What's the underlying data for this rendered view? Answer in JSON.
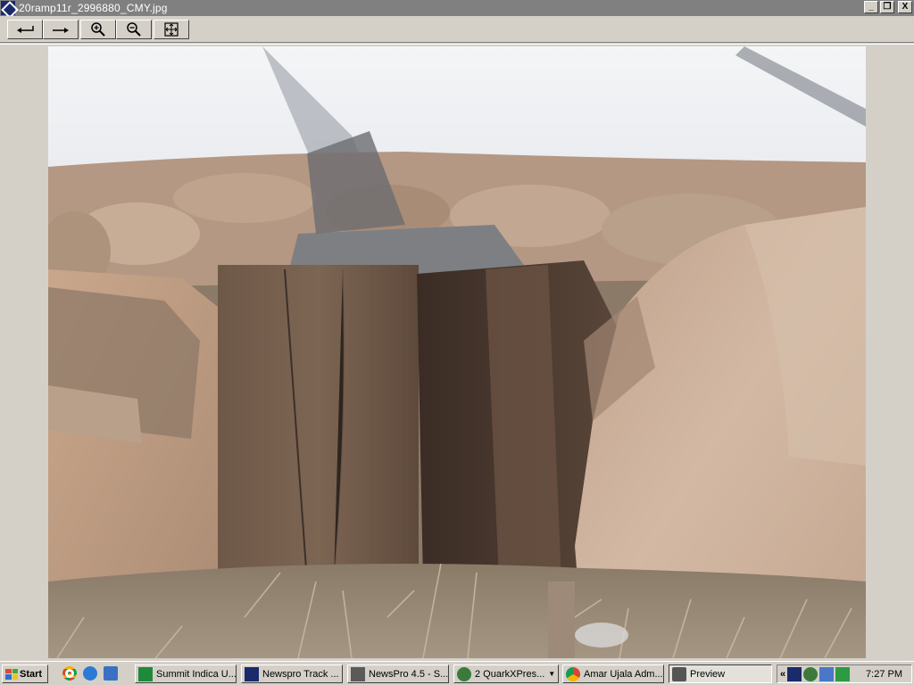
{
  "window": {
    "title": "20ramp11r_2996880_CMY.jpg",
    "minimize_label": "_",
    "restore_label": "❐",
    "close_label": "X"
  },
  "toolbar": {
    "buttons": [
      {
        "name": "previous-button",
        "icon": "arrow-left-icon"
      },
      {
        "name": "next-button",
        "icon": "arrow-right-icon"
      },
      {
        "name": "zoom-in-button",
        "icon": "zoom-in-icon"
      },
      {
        "name": "zoom-out-button",
        "icon": "zoom-out-icon"
      },
      {
        "name": "fit-to-window-button",
        "icon": "fit-window-icon"
      }
    ]
  },
  "image": {
    "subject": "mud-wall-doorway-photo"
  },
  "taskbar": {
    "start_label": "Start",
    "tasks": [
      {
        "label": "Summit Indica U...",
        "icon": "summit-app-icon"
      },
      {
        "label": "Newspro Track ...",
        "icon": "newspro-icon"
      },
      {
        "label": "NewsPro 4.5 - S...",
        "icon": "newspro-window-icon"
      },
      {
        "label": "2 QuarkXPres...",
        "icon": "quarkxpress-icon"
      },
      {
        "label": "Amar Ujala Adm...",
        "icon": "chrome-icon"
      },
      {
        "label": "Preview",
        "icon": "preview-icon"
      }
    ],
    "tray_expand": "«",
    "clock": "7:27 PM"
  },
  "colors": {
    "titlebar": "#808080",
    "chrome": "#d4d0c8",
    "accent_blue": "#1b2a6b"
  }
}
